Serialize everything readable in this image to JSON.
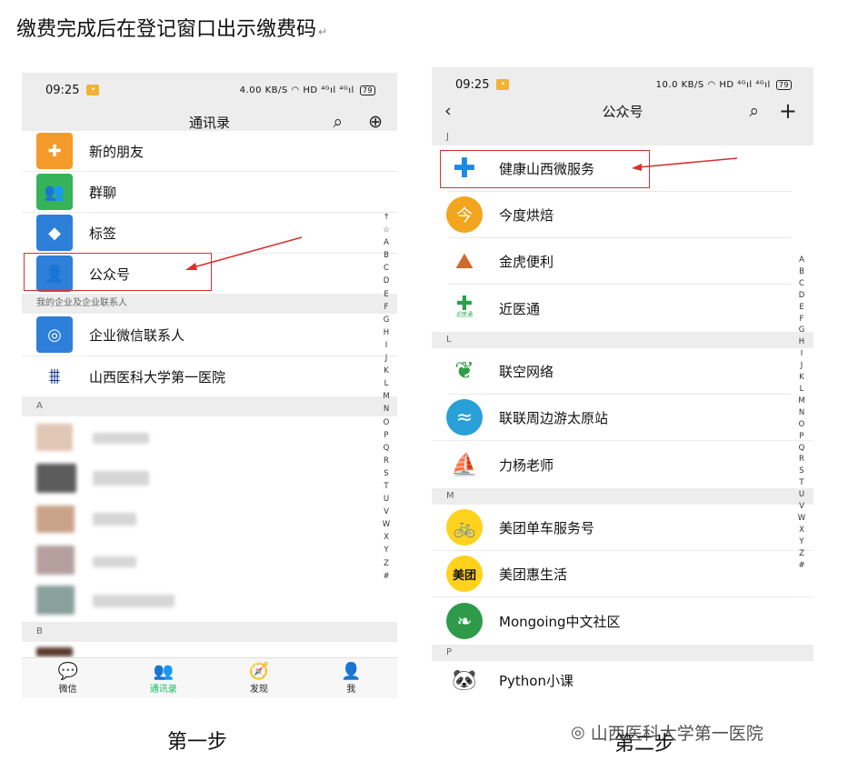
{
  "heading": "缴费完成后在登记窗口出示缴费码",
  "heading_mark": "↵",
  "step1_caption": "第一步",
  "step2_caption": "第二步",
  "watermark": "山西医科大学第一医院",
  "left_phone": {
    "time": "09:25",
    "status_right": "4.00 KB/S ◠ HD ⁴ᴳıl ⁴ᴳıl",
    "battery": "79",
    "title": "通讯录",
    "rows": [
      {
        "label": "新的朋友",
        "color": "#f59b2b",
        "glyph": "person-add-icon"
      },
      {
        "label": "群聊",
        "color": "#36b35a",
        "glyph": "group-icon"
      },
      {
        "label": "标签",
        "color": "#2e7fd9",
        "glyph": "tag-icon"
      },
      {
        "label": "公众号",
        "color": "#2e7fd9",
        "glyph": "official-account-icon"
      }
    ],
    "enterprise_header": "我的企业及企业联系人",
    "enterprise_rows": [
      {
        "label": "企业微信联系人"
      },
      {
        "label": "山西医科大学第一医院"
      }
    ],
    "section_a": "A",
    "section_b": "B",
    "index_letters": [
      "↑",
      "☆",
      "A",
      "B",
      "C",
      "D",
      "E",
      "F",
      "G",
      "H",
      "I",
      "J",
      "K",
      "L",
      "M",
      "N",
      "O",
      "P",
      "Q",
      "R",
      "S",
      "T",
      "U",
      "V",
      "W",
      "X",
      "Y",
      "Z",
      "#"
    ],
    "tabs": [
      "微信",
      "通讯录",
      "发现",
      "我"
    ]
  },
  "right_phone": {
    "time": "09:25",
    "status_right": "10.0 KB/S ◠ HD ⁴ᴳıl ⁴ᴳıl",
    "battery": "79",
    "title": "公众号",
    "sections": [
      {
        "letter": "J",
        "items": [
          "健康山西微服务",
          "今度烘焙",
          "金虎便利",
          "近医通"
        ]
      },
      {
        "letter": "L",
        "items": [
          "联空网络",
          "联联周边游太原站",
          "力杨老师"
        ]
      },
      {
        "letter": "M",
        "items": [
          "美团单车服务号",
          "美团惠生活",
          "Mongoing中文社区"
        ]
      },
      {
        "letter": "P",
        "items": [
          "Python小课"
        ]
      }
    ],
    "index_letters": [
      "A",
      "B",
      "C",
      "D",
      "E",
      "F",
      "G",
      "H",
      "I",
      "J",
      "K",
      "L",
      "M",
      "N",
      "O",
      "P",
      "Q",
      "R",
      "S",
      "T",
      "U",
      "V",
      "W",
      "X",
      "Y",
      "Z",
      "#"
    ],
    "meituan_text": "美团",
    "jinyitong_text": "近医通"
  }
}
